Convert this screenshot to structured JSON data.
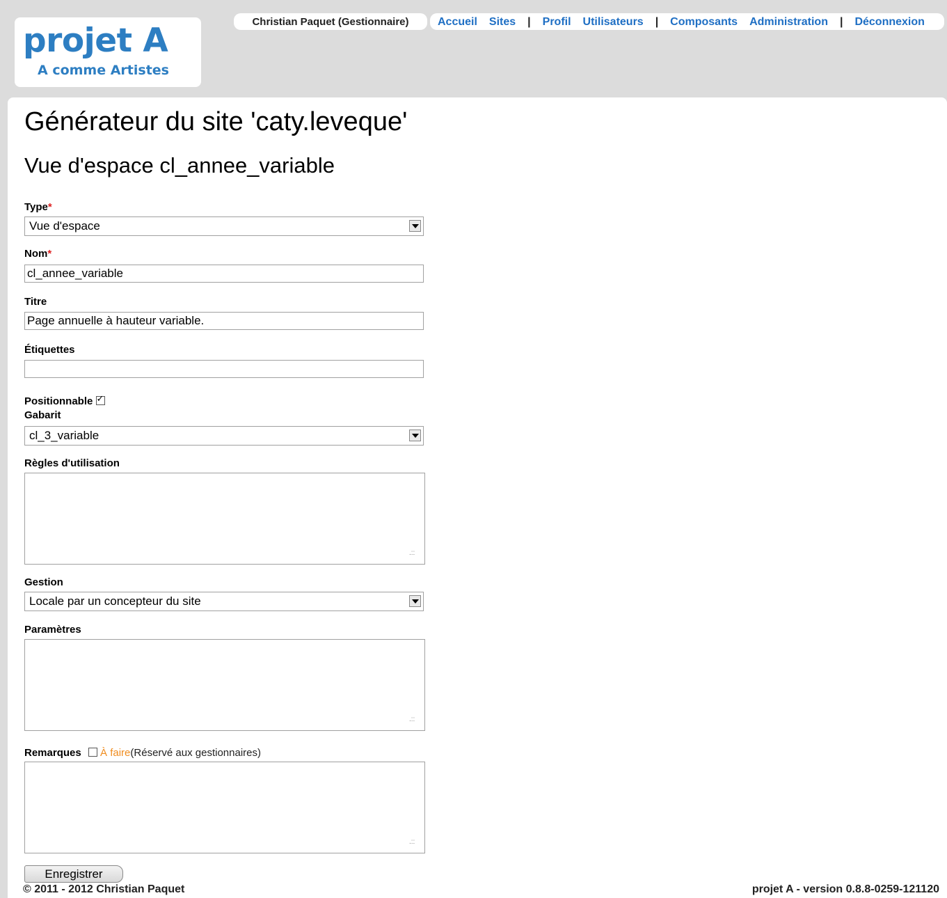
{
  "logo": {
    "title": "projet A",
    "subtitle": "A comme Artistes"
  },
  "header": {
    "user": "Christian Paquet (Gestionnaire)",
    "nav": [
      {
        "label": "Accueil"
      },
      {
        "label": "Sites"
      },
      {
        "sep": "|"
      },
      {
        "label": "Profil"
      },
      {
        "label": "Utilisateurs"
      },
      {
        "sep": "|"
      },
      {
        "label": "Composants"
      },
      {
        "label": "Administration"
      },
      {
        "sep": "|"
      },
      {
        "label": "Déconnexion"
      }
    ]
  },
  "page": {
    "title": "Générateur du site 'caty.leveque'",
    "subtitle": "Vue d'espace cl_annee_variable"
  },
  "form": {
    "required_mark": "*",
    "type": {
      "label": "Type",
      "value": "Vue d'espace"
    },
    "nom": {
      "label": "Nom",
      "value": "cl_annee_variable"
    },
    "titre": {
      "label": "Titre",
      "value": "Page annuelle à hauteur variable."
    },
    "etiquettes": {
      "label": "Étiquettes",
      "value": ""
    },
    "positionnable": {
      "label": "Positionnable",
      "checked": true
    },
    "gabarit": {
      "label": "Gabarit",
      "value": "cl_3_variable"
    },
    "regles": {
      "label": "Règles d'utilisation",
      "value": ""
    },
    "gestion": {
      "label": "Gestion",
      "value": "Locale par un concepteur du site"
    },
    "parametres": {
      "label": "Paramètres",
      "value": ""
    },
    "remarques": {
      "label": "Remarques",
      "todo_label": "À faire",
      "todo_color": "#f08c1e",
      "todo_note": "(Réservé aux gestionnaires)",
      "todo_checked": false,
      "value": ""
    },
    "submit_label": "Enregistrer"
  },
  "footer": {
    "copyright": "© 2011 - 2012 Christian Paquet",
    "version": "projet A - version 0.8.8-0259-121120"
  },
  "colors": {
    "link": "#1f6fc4",
    "logo": "#2d7ec2",
    "background": "#dcdcdc"
  }
}
